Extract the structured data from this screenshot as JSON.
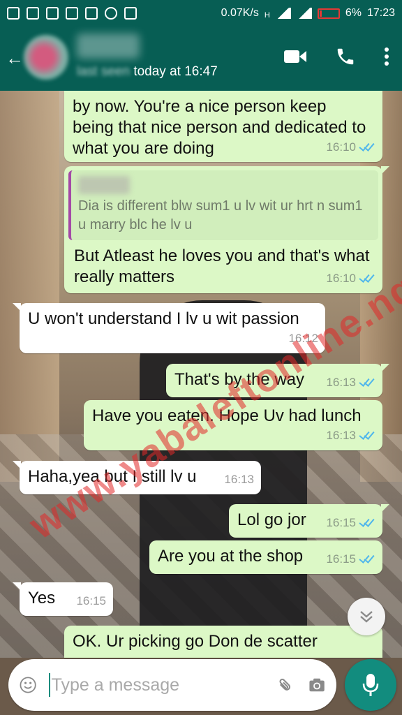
{
  "status_bar": {
    "network_speed": "0.07K/s",
    "signal_type": "H",
    "battery": "6%",
    "time": "17:23"
  },
  "header": {
    "last_seen": "today at 16:47",
    "last_seen_prefix": "last seen"
  },
  "messages": [
    {
      "direction": "out",
      "text": "by now. You're a nice person keep being that nice person and dedicated to what you are doing",
      "time": "16:10",
      "status": "read"
    },
    {
      "direction": "out",
      "quote": "Dia is different blw sum1  u lv wit ur hrt n sum1 u marry blc he lv u",
      "text": "But Atleast he loves you and that's what really matters",
      "time": "16:10",
      "status": "read"
    },
    {
      "direction": "in",
      "text": "U won't understand I lv u wit passion",
      "time": "16:12"
    },
    {
      "direction": "out",
      "text": "That's by the way",
      "time": "16:13",
      "status": "read"
    },
    {
      "direction": "out",
      "text": "Have you eaten. Hope Uv had lunch",
      "time": "16:13",
      "status": "read"
    },
    {
      "direction": "in",
      "text": "Haha,yea but I still lv u",
      "time": "16:13"
    },
    {
      "direction": "out",
      "text": "Lol go jor",
      "time": "16:15",
      "status": "read"
    },
    {
      "direction": "out",
      "text": "Are you at the shop",
      "time": "16:15",
      "status": "read"
    },
    {
      "direction": "in",
      "text": "Yes",
      "time": "16:15"
    },
    {
      "direction": "out",
      "text": "OK. Ur picking go Don de scatter",
      "time": ""
    }
  ],
  "composer": {
    "placeholder": "Type a message"
  },
  "watermark": "www.yabaleftonline.ng",
  "colors": {
    "header": "#075e54",
    "outgoing_bubble": "#dcf8c6",
    "incoming_bubble": "#ffffff",
    "accent": "#128c7e",
    "read_tick": "#4fb6ec"
  },
  "icons": [
    "video-call-icon",
    "voice-call-icon",
    "more-options-icon",
    "emoji-icon",
    "attach-icon",
    "camera-icon",
    "mic-icon",
    "scroll-down-icon"
  ]
}
